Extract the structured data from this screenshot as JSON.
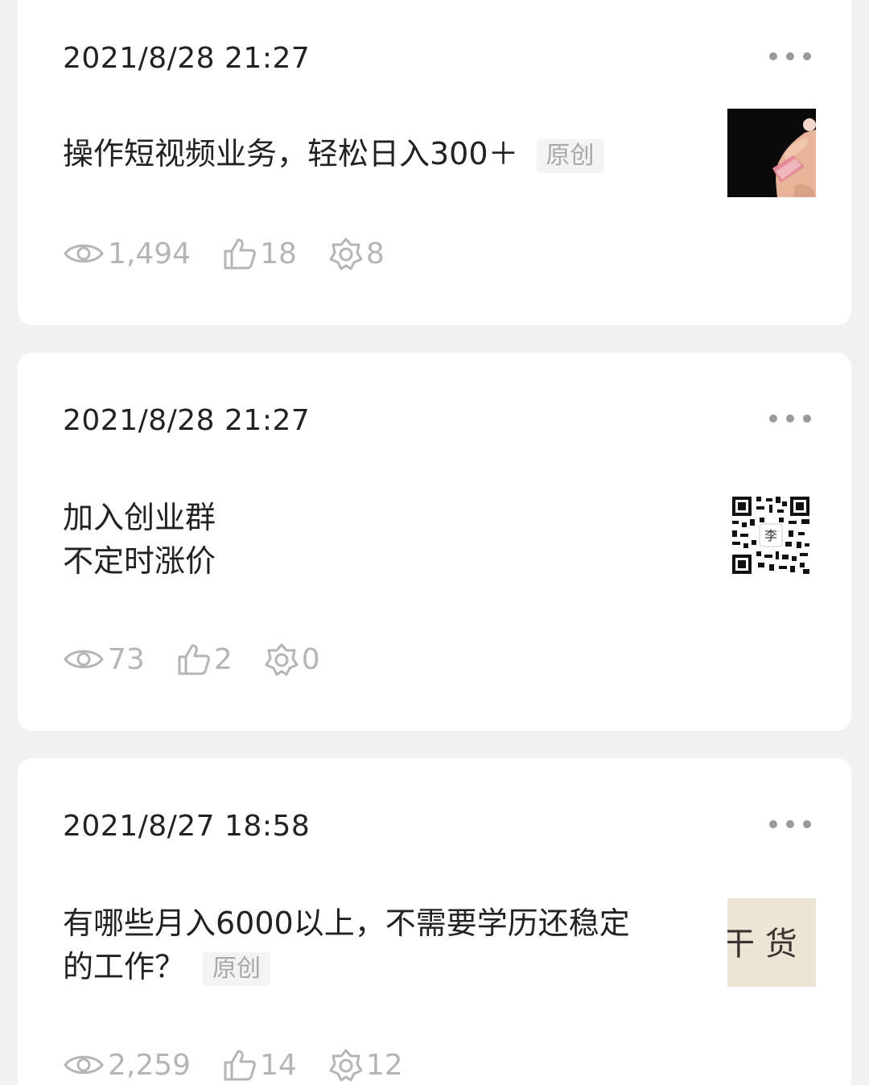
{
  "posts": [
    {
      "timestamp": "2021/8/28 21:27",
      "title_lines": [
        "操作短视频业务，轻松日入300＋"
      ],
      "badge": "原创",
      "thumbnail_icon": "hand-money-photo",
      "stats": {
        "views": "1,494",
        "likes": "18",
        "shares": "8"
      }
    },
    {
      "timestamp": "2021/8/28 21:27",
      "title_lines": [
        "加入创业群",
        "不定时涨价"
      ],
      "badge": "",
      "thumbnail_icon": "qr-code-image",
      "thumbnail_center_text": "李",
      "stats": {
        "views": "73",
        "likes": "2",
        "shares": "0"
      }
    },
    {
      "timestamp": "2021/8/27 18:58",
      "title_lines": [
        "有哪些月入6000以上，不需要学历还稳定",
        "的工作？"
      ],
      "badge": "原创",
      "thumbnail_icon": "calligraphy-image",
      "thumbnail_text": "干  货",
      "stats": {
        "views": "2,259",
        "likes": "14",
        "shares": "12"
      }
    }
  ],
  "colors": {
    "background": "#f1f1f1",
    "card": "#ffffff",
    "text_primary": "#222222",
    "text_meta": "#b5b5b5",
    "badge_bg": "#f3f3f3",
    "badge_text": "#a8a8a8"
  }
}
